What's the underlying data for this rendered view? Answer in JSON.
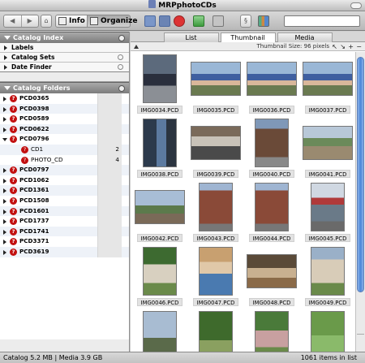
{
  "window": {
    "title": "MRPphotoCDs"
  },
  "toolbar": {
    "info_label": "Info",
    "organize_label": "Organize",
    "search_placeholder": ""
  },
  "catalog_index": {
    "header": "Catalog Index",
    "items": [
      {
        "label": "Labels"
      },
      {
        "label": "Catalog Sets"
      },
      {
        "label": "Date Finder"
      }
    ]
  },
  "catalog_folders": {
    "header": "Catalog Folders",
    "items": [
      {
        "label": "PCD0365",
        "count": "",
        "child": false,
        "open": false
      },
      {
        "label": "PCD0398",
        "count": "",
        "child": false,
        "open": false
      },
      {
        "label": "PCD0589",
        "count": "",
        "child": false,
        "open": false
      },
      {
        "label": "PCD0622",
        "count": "",
        "child": false,
        "open": false
      },
      {
        "label": "PCD0796",
        "count": "",
        "child": false,
        "open": true
      },
      {
        "label": "CD1",
        "count": "2",
        "child": true,
        "open": false
      },
      {
        "label": "PHOTO_CD",
        "count": "4",
        "child": true,
        "open": false
      },
      {
        "label": "PCD0797",
        "count": "",
        "child": false,
        "open": false
      },
      {
        "label": "PCD1062",
        "count": "",
        "child": false,
        "open": false
      },
      {
        "label": "PCD1361",
        "count": "",
        "child": false,
        "open": false
      },
      {
        "label": "PCD1508",
        "count": "",
        "child": false,
        "open": false
      },
      {
        "label": "PCD1601",
        "count": "",
        "child": false,
        "open": false
      },
      {
        "label": "PCD1737",
        "count": "",
        "child": false,
        "open": false
      },
      {
        "label": "PCD1741",
        "count": "",
        "child": false,
        "open": false
      },
      {
        "label": "PCD3371",
        "count": "",
        "child": false,
        "open": false
      },
      {
        "label": "PCD3619",
        "count": "",
        "child": false,
        "open": false
      }
    ]
  },
  "tabs": [
    {
      "label": "List",
      "active": false
    },
    {
      "label": "Thumbnail",
      "active": true
    },
    {
      "label": "Media",
      "active": false
    }
  ],
  "thumbnail_size_label": "Thumbnail Size: 96 pixels",
  "thumbnails": [
    {
      "label": "IMG0034.PCD",
      "scene": "people-group-car",
      "orientation": "portrait"
    },
    {
      "label": "IMG0035.PCD",
      "scene": "people-group",
      "orientation": "landscape"
    },
    {
      "label": "IMG0036.PCD",
      "scene": "people-group",
      "orientation": "landscape"
    },
    {
      "label": "IMG0037.PCD",
      "scene": "people-group",
      "orientation": "landscape"
    },
    {
      "label": "IMG0038.PCD",
      "scene": "doorway",
      "orientation": "portrait"
    },
    {
      "label": "IMG0039.PCD",
      "scene": "machinery",
      "orientation": "landscape"
    },
    {
      "label": "IMG0040.PCD",
      "scene": "building",
      "orientation": "portrait"
    },
    {
      "label": "IMG0041.PCD",
      "scene": "street",
      "orientation": "landscape"
    },
    {
      "label": "IMG0042.PCD",
      "scene": "town-view",
      "orientation": "landscape"
    },
    {
      "label": "IMG0043.PCD",
      "scene": "brick-building",
      "orientation": "portrait"
    },
    {
      "label": "IMG0044.PCD",
      "scene": "brick-building",
      "orientation": "portrait"
    },
    {
      "label": "IMG0045.PCD",
      "scene": "flag-street",
      "orientation": "portrait"
    },
    {
      "label": "IMG0046.PCD",
      "scene": "house-tree",
      "orientation": "portrait"
    },
    {
      "label": "IMG0047.PCD",
      "scene": "man-portrait",
      "orientation": "portrait"
    },
    {
      "label": "IMG0048.PCD",
      "scene": "dining",
      "orientation": "landscape"
    },
    {
      "label": "IMG0049.PCD",
      "scene": "house",
      "orientation": "portrait"
    },
    {
      "label": "",
      "scene": "monument",
      "orientation": "portrait"
    },
    {
      "label": "",
      "scene": "tree-path",
      "orientation": "portrait"
    },
    {
      "label": "",
      "scene": "people-outdoor",
      "orientation": "portrait"
    },
    {
      "label": "",
      "scene": "park",
      "orientation": "portrait"
    }
  ],
  "status": {
    "catalog": "Catalog  5.2 MB  |  Media 3.9 GB",
    "items": "1061 items in list"
  },
  "colors": {
    "scrollbar": "#4a86d8",
    "folder_icon": "#c21010"
  },
  "icons": {
    "back": "chevron-left-icon",
    "forward": "chevron-right-icon",
    "home": "home-icon",
    "info": "info-icon",
    "organize": "organize-icon"
  }
}
